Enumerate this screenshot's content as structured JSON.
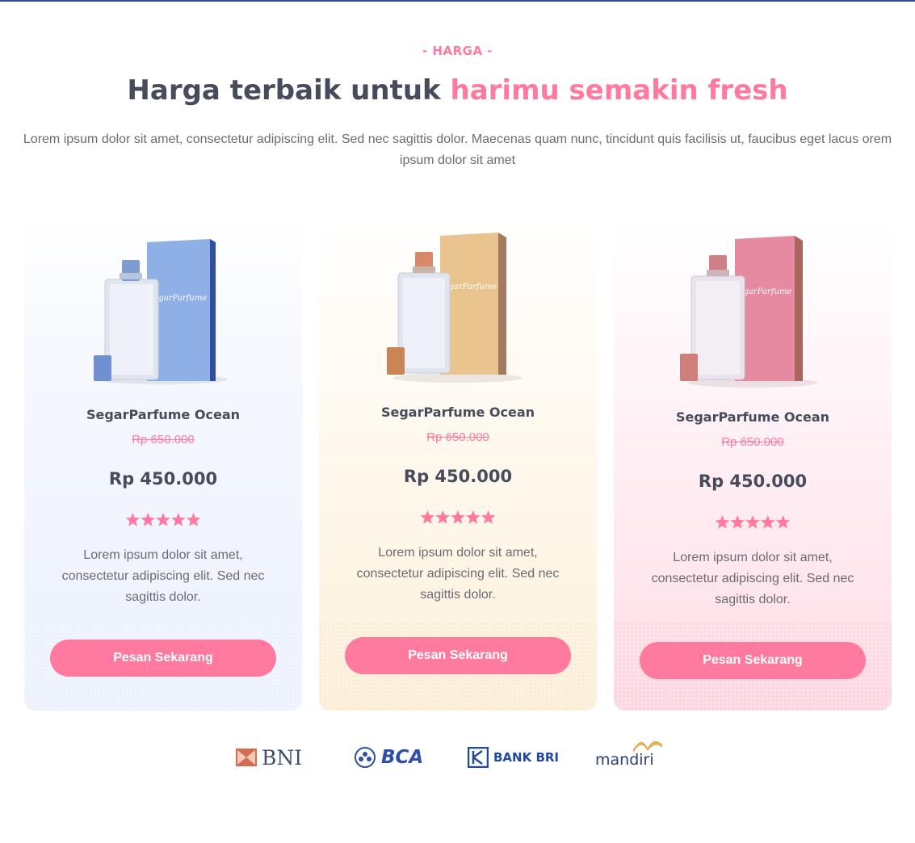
{
  "section": {
    "eyebrow": "- HARGA -",
    "headline_main": "Harga terbaik untuk ",
    "headline_accent": "harimu semakin fresh",
    "intro": "Lorem ipsum dolor sit amet, consectetur adipiscing elit. Sed nec sagittis dolor. Maecenas quam nunc, tincidunt quis facilisis ut, faucibus eget lacus orem ipsum dolor sit amet"
  },
  "colors": {
    "accent": "#ff7a9e",
    "heading": "#474c5c",
    "body_text": "#6d6a72",
    "ocean_box": "#8fb0e6",
    "gold_box": "#e9c48e",
    "rose_box": "#e58aa0"
  },
  "products": [
    {
      "name": "SegarParfume Ocean",
      "old_price": "Rp 650.000",
      "price": "Rp 450.000",
      "rating": 5,
      "rating_max": 5,
      "description": "Lorem ipsum dolor sit amet, consectetur adipiscing elit. Sed nec sagittis dolor.",
      "cta": "Pesan Sekarang",
      "box_label": "SegarParfume",
      "image_icon": "perfume-bottle-blue-icon"
    },
    {
      "name": "SegarParfume Ocean",
      "old_price": "Rp 650.000",
      "price": "Rp 450.000",
      "rating": 5,
      "rating_max": 5,
      "description": "Lorem ipsum dolor sit amet, consectetur adipiscing elit. Sed nec sagittis dolor.",
      "cta": "Pesan Sekarang",
      "box_label": "SegarParfume",
      "image_icon": "perfume-bottle-gold-icon"
    },
    {
      "name": "SegarParfume Ocean",
      "old_price": "Rp 650.000",
      "price": "Rp 450.000",
      "rating": 5,
      "rating_max": 5,
      "description": "Lorem ipsum dolor sit amet, consectetur adipiscing elit. Sed nec sagittis dolor.",
      "cta": "Pesan Sekarang",
      "box_label": "SegarParfume",
      "image_icon": "perfume-bottle-pink-icon"
    }
  ],
  "payment_logos": [
    {
      "label": "BNI",
      "icon": "bni-logo-icon"
    },
    {
      "label": "BCA",
      "icon": "bca-logo-icon"
    },
    {
      "label": "BANK BRI",
      "icon": "bri-logo-icon"
    },
    {
      "label": "mandiri",
      "icon": "mandiri-logo-icon"
    }
  ]
}
